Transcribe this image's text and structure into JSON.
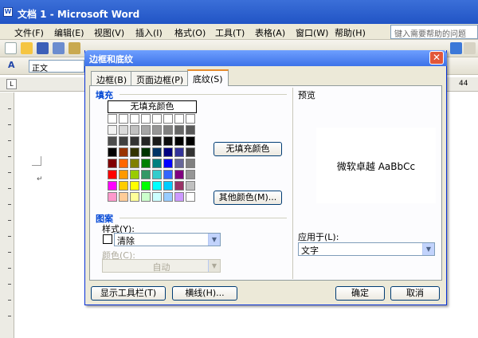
{
  "window": {
    "title": "文档 1 - Microsoft Word"
  },
  "menubar": {
    "items": [
      "文件(F)",
      "编辑(E)",
      "视图(V)",
      "插入(I)",
      "格式(O)",
      "工具(T)",
      "表格(A)",
      "窗口(W)",
      "帮助(H)"
    ],
    "help_placeholder": "键入需要帮助的问题"
  },
  "toolbar": {
    "style_value": "正文",
    "ruler_number": "44"
  },
  "dialog": {
    "title": "边框和底纹",
    "tabs": [
      "边框(B)",
      "页面边框(P)",
      "底纹(S)"
    ],
    "fill": {
      "label": "填充",
      "no_fill_cell": "无填充颜色",
      "no_fill_button": "无填充颜色",
      "more_colors_button": "其他颜色(M)...",
      "palette_colors": [
        [
          "#ffffff",
          "#ffffff",
          "#ffffff",
          "#ffffff",
          "#ffffff",
          "#ffffff",
          "#ffffff",
          "#ffffff"
        ],
        [
          "#f2f2f2",
          "#d9d9d9",
          "#c0c0c0",
          "#a6a6a6",
          "#969696",
          "#808080",
          "#666666",
          "#595959"
        ],
        [
          "#4d4d4d",
          "#404040",
          "#333333",
          "#262626",
          "#1a1a1a",
          "#0d0d0d",
          "#000000",
          "#000000"
        ],
        [
          "#000000",
          "#993300",
          "#333300",
          "#003300",
          "#003366",
          "#000080",
          "#333399",
          "#333333"
        ],
        [
          "#800000",
          "#ff6600",
          "#808000",
          "#008000",
          "#008080",
          "#0000ff",
          "#666699",
          "#808080"
        ],
        [
          "#ff0000",
          "#ff9900",
          "#99cc00",
          "#339966",
          "#33cccc",
          "#3366ff",
          "#800080",
          "#969696"
        ],
        [
          "#ff00ff",
          "#ffcc00",
          "#ffff00",
          "#00ff00",
          "#00ffff",
          "#00ccff",
          "#993366",
          "#c0c0c0"
        ],
        [
          "#ff99cc",
          "#ffcc99",
          "#ffff99",
          "#ccffcc",
          "#ccffff",
          "#99ccff",
          "#cc99ff",
          "#ffffff"
        ]
      ]
    },
    "pattern": {
      "label": "图案",
      "style_label": "样式(Y):",
      "style_value": "清除",
      "color_label": "颜色(C):",
      "color_value": "自动"
    },
    "preview": {
      "label": "预览",
      "sample_text": "微软卓越 AaBbCc",
      "apply_label": "应用于(L):",
      "apply_value": "文字"
    },
    "buttons": {
      "show_toolbar": "显示工具栏(T)",
      "horizontal_line": "横线(H)...",
      "ok": "确定",
      "cancel": "取消"
    }
  }
}
